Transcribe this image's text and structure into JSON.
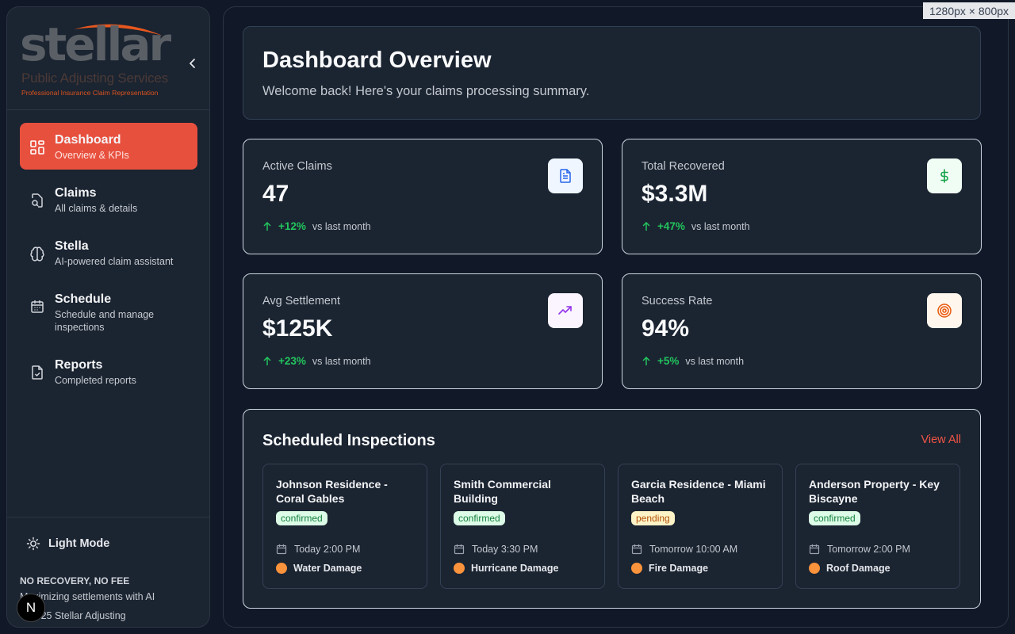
{
  "brand": {
    "word": "stellar",
    "subtitle": "Public Adjusting Services",
    "tagline": "Professional Insurance Claim Representation"
  },
  "sidebar": {
    "items": [
      {
        "label": "Dashboard",
        "desc": "Overview & KPIs",
        "icon": "dashboard-icon",
        "active": true
      },
      {
        "label": "Claims",
        "desc": "All claims & details",
        "icon": "file-search-icon"
      },
      {
        "label": "Stella",
        "desc": "AI-powered claim assistant",
        "icon": "brain-icon"
      },
      {
        "label": "Schedule",
        "desc": "Schedule and manage inspections",
        "icon": "calendar-icon"
      },
      {
        "label": "Reports",
        "desc": "Completed reports",
        "icon": "file-check-icon"
      }
    ],
    "footer": {
      "mode_label": "Light Mode",
      "title": "NO RECOVERY, NO FEE",
      "line": "Maximizing settlements with AI",
      "copyright": "© 2025 Stellar Adjusting"
    },
    "next_badge": "N"
  },
  "header": {
    "title": "Dashboard Overview",
    "subtitle": "Welcome back! Here's your claims processing summary."
  },
  "kpis": [
    {
      "label": "Active Claims",
      "value": "47",
      "change": "+12%",
      "vs": "vs last month",
      "icon": "document-icon",
      "icon_color": "#2563eb",
      "icon_bg": "#eff6ff"
    },
    {
      "label": "Total Recovered",
      "value": "$3.3M",
      "change": "+47%",
      "vs": "vs last month",
      "icon": "dollar-icon",
      "icon_color": "#16a34a",
      "icon_bg": "#f0fdf4"
    },
    {
      "label": "Avg Settlement",
      "value": "$125K",
      "change": "+23%",
      "vs": "vs last month",
      "icon": "trending-up-icon",
      "icon_color": "#9333ea",
      "icon_bg": "#faf5ff"
    },
    {
      "label": "Success Rate",
      "value": "94%",
      "change": "+5%",
      "vs": "vs last month",
      "icon": "target-icon",
      "icon_color": "#ea580c",
      "icon_bg": "#fff7ed"
    }
  ],
  "inspections": {
    "title": "Scheduled Inspections",
    "view_all": "View All",
    "items": [
      {
        "name": "Johnson Residence - Coral Gables",
        "status": "confirmed",
        "time": "Today 2:00 PM",
        "type": "Water Damage"
      },
      {
        "name": "Smith Commercial Building",
        "status": "confirmed",
        "time": "Today 3:30 PM",
        "type": "Hurricane Damage"
      },
      {
        "name": "Garcia Residence - Miami Beach",
        "status": "pending",
        "time": "Tomorrow 10:00 AM",
        "type": "Fire Damage"
      },
      {
        "name": "Anderson Property - Key Biscayne",
        "status": "confirmed",
        "time": "Tomorrow 2:00 PM",
        "type": "Roof Damage"
      }
    ]
  },
  "colors": {
    "accent": "#e8503e",
    "positive": "#22c55e",
    "bg": "#111827",
    "card": "#1b2431"
  },
  "overlay": {
    "dimensions": "1280px × 800px"
  }
}
